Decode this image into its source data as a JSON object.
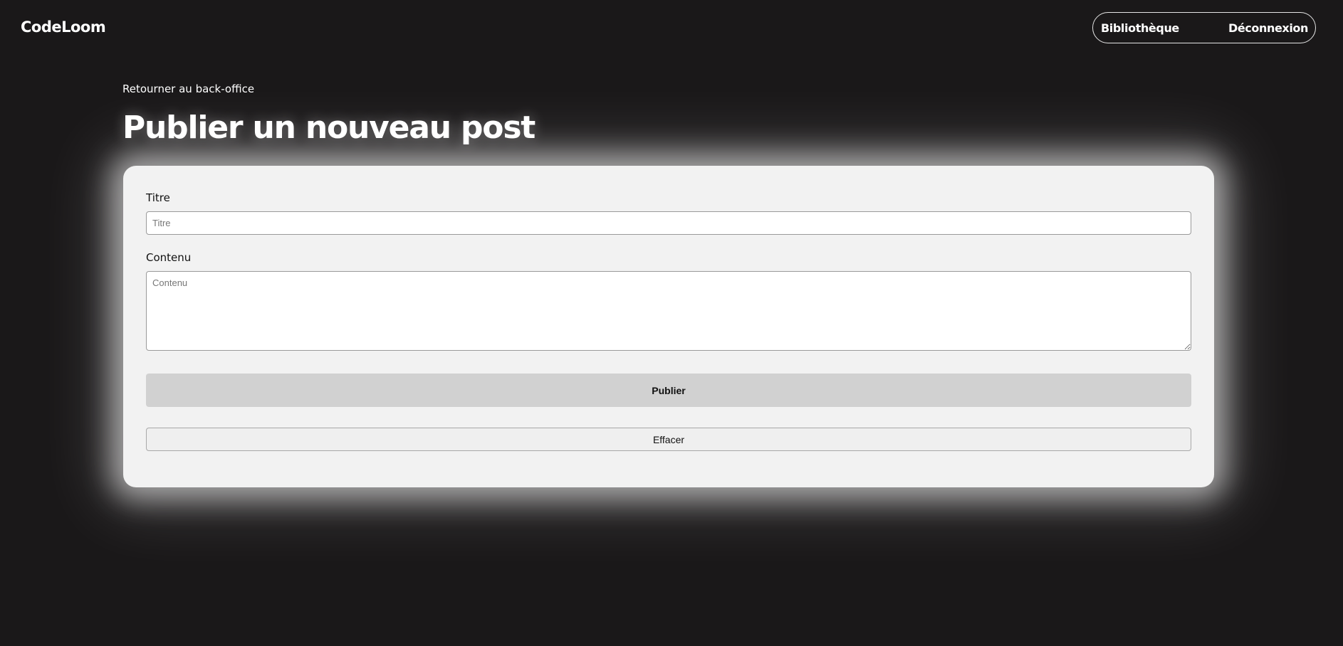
{
  "header": {
    "logo": "CodeLoom",
    "nav": [
      {
        "label": "Bibliothèque"
      },
      {
        "label": "Déconnexion"
      }
    ]
  },
  "page": {
    "back_link": "Retourner au back-office",
    "title": "Publier un nouveau post"
  },
  "form": {
    "title_label": "Titre",
    "title_placeholder": "Titre",
    "title_value": "",
    "content_label": "Contenu",
    "content_placeholder": "Contenu",
    "content_value": "",
    "publish_label": "Publier",
    "clear_label": "Effacer"
  },
  "colors": {
    "background": "#1a1819",
    "card": "#f2f2f2",
    "publish_button": "#d1d1d1",
    "text_light": "#ffffff",
    "text_dark": "#111111"
  }
}
